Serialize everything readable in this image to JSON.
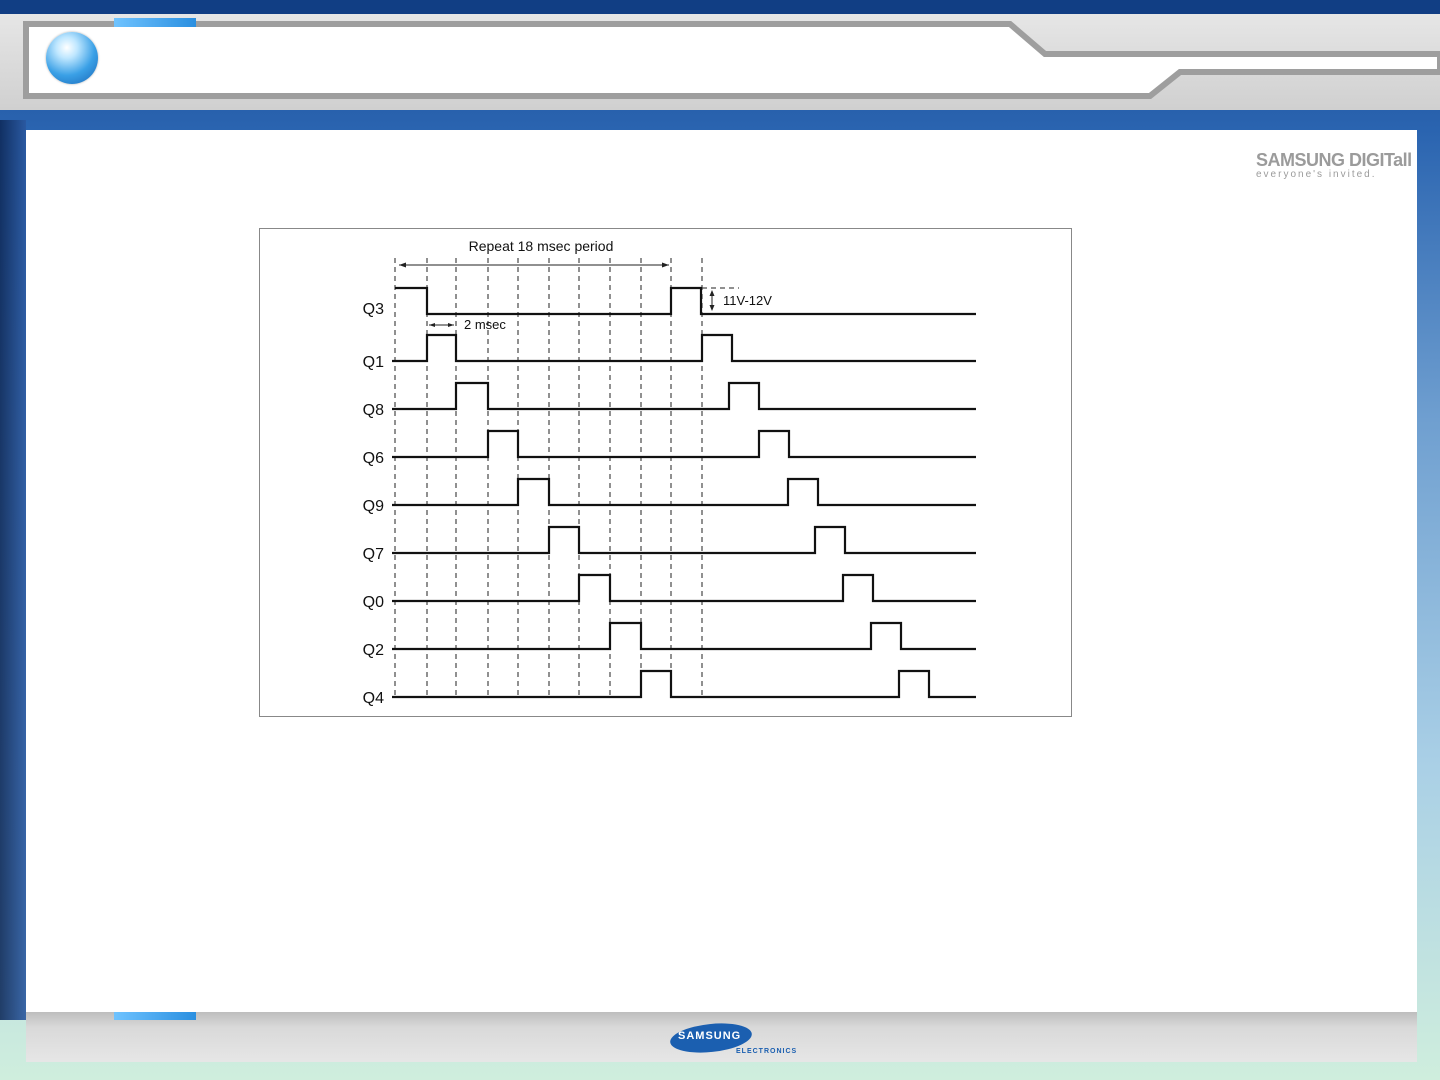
{
  "brand": {
    "top_line": "SAMSUNG DIGITall",
    "top_sub": "everyone's invited.",
    "footer_name": "SAMSUNG",
    "footer_sub": "ELECTRONICS"
  },
  "diagram": {
    "period_label": "Repeat 18 msec period",
    "step_label": "2 msec",
    "voltage_label": "11V-12V",
    "channels": [
      "Q3",
      "Q1",
      "Q8",
      "Q6",
      "Q9",
      "Q7",
      "Q0",
      "Q2",
      "Q4"
    ]
  }
}
